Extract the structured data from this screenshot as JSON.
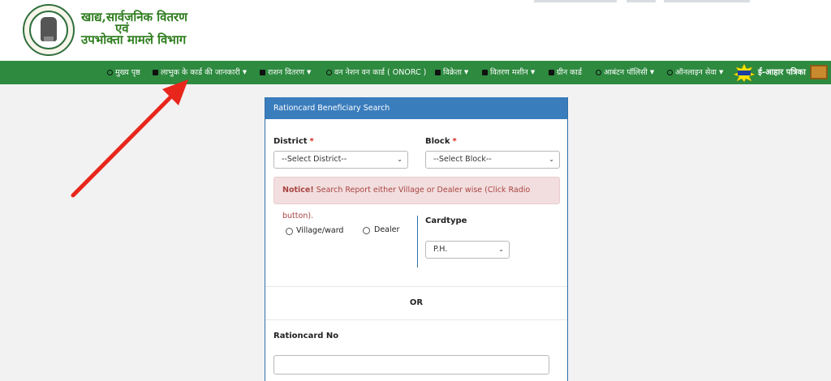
{
  "header": {
    "dept_line1": "खाद्य,सार्वजनिक वितरण",
    "dept_line2": "एवं",
    "dept_line3": "उपभोक्ता मामले विभाग"
  },
  "nav": {
    "items": [
      {
        "label": "मुख्य पृष्ठ",
        "icon": "clock-icon"
      },
      {
        "label": "लाभुक के कार्ड की जानकारी",
        "icon": "card-icon"
      },
      {
        "label": "राशन वितरण",
        "icon": "user-icon"
      },
      {
        "label": "वन नेशन वन कार्ड ( ONORC )",
        "icon": "circle-icon"
      },
      {
        "label": "विक्रेता",
        "icon": "user-icon"
      },
      {
        "label": "वितरण मशीन",
        "icon": "machine-icon"
      },
      {
        "label": "ग्रीन कार्ड",
        "icon": "shuffle-icon"
      },
      {
        "label": "आबंटन पॉलिसी",
        "icon": "policy-icon"
      },
      {
        "label": "ऑनलाइन सेवा",
        "icon": "globe-icon"
      }
    ],
    "eahar_label": "ई-आहार पत्रिका"
  },
  "form": {
    "title": "Rationcard Beneficiary Search",
    "district_label": "District",
    "district_value": "--Select District--",
    "block_label": "Block",
    "block_value": "--Select Block--",
    "required_mark": "*",
    "notice_strong": "Notice!",
    "notice_text": " Search Report either Village or Dealer wise (Click Radio button).",
    "radio_village": "Village/ward",
    "radio_dealer": "Dealer",
    "cardtype_label": "Cardtype",
    "cardtype_value": "P.H.",
    "or_text": "OR",
    "rationcard_label": "Rationcard No",
    "rationcard_value": ""
  },
  "colors": {
    "nav_green": "#2d8a3f",
    "panel_blue": "#3a7dbd",
    "notice_bg": "#f2dede",
    "arrow_red": "#e8261c"
  }
}
